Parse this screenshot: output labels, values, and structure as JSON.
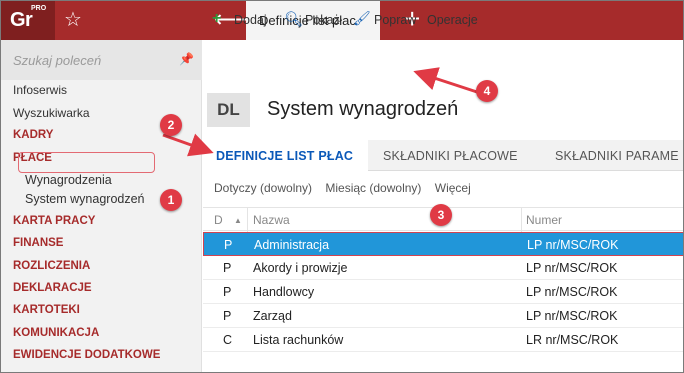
{
  "app": {
    "logo": "Gr",
    "logo_sup": "PRO",
    "active_tab": "Definicje list płac"
  },
  "sidebar": {
    "search_placeholder": "Szukaj poleceń",
    "items": [
      {
        "label": "Infoserwis",
        "kind": "plain"
      },
      {
        "label": "Wyszukiwarka",
        "kind": "plain"
      },
      {
        "label": "KADRY",
        "kind": "section"
      },
      {
        "label": "PŁACE",
        "kind": "section"
      },
      {
        "label": "Wynagrodzenia",
        "kind": "sub"
      },
      {
        "label": "System wynagrodzeń",
        "kind": "sub"
      },
      {
        "label": "KARTA PRACY",
        "kind": "section"
      },
      {
        "label": "FINANSE",
        "kind": "section"
      },
      {
        "label": "ROZLICZENIA",
        "kind": "section"
      },
      {
        "label": "DEKLARACJE",
        "kind": "section"
      },
      {
        "label": "KARTOTEKI",
        "kind": "section"
      },
      {
        "label": "KOMUNIKACJA",
        "kind": "section"
      },
      {
        "label": "EWIDENCJE DODATKOWE",
        "kind": "section"
      }
    ]
  },
  "toolbar": {
    "add": "Dodaj",
    "show": "Pokaż",
    "edit": "Popraw",
    "operations": "Operacje"
  },
  "header": {
    "badge": "DL",
    "title": "System wynagrodzeń"
  },
  "tabs": [
    "DEFINICJE LIST PŁAC",
    "SKŁADNIKI PŁACOWE",
    "SKŁADNIKI PARAME"
  ],
  "filters": [
    "Dotyczy (dowolny)",
    "Miesiąc (dowolny)",
    "Więcej"
  ],
  "table": {
    "columns": [
      "D",
      "Nazwa",
      "Numer"
    ],
    "rows": [
      {
        "d": "P",
        "name": "Administracja",
        "number": "LP nr/MSC/ROK",
        "selected": true
      },
      {
        "d": "P",
        "name": "Akordy i prowizje",
        "number": "LP nr/MSC/ROK",
        "selected": false
      },
      {
        "d": "P",
        "name": "Handlowcy",
        "number": "LP nr/MSC/ROK",
        "selected": false
      },
      {
        "d": "P",
        "name": "Zarząd",
        "number": "LP nr/MSC/ROK",
        "selected": false
      },
      {
        "d": "C",
        "name": "Lista rachunków",
        "number": "LR nr/MSC/ROK",
        "selected": false
      }
    ]
  },
  "callouts": [
    "1",
    "2",
    "3",
    "4"
  ],
  "colors": {
    "brand": "#a62b2b",
    "accent_blue": "#0a58b8",
    "selection": "#2196d9",
    "callout": "#e03a45"
  }
}
